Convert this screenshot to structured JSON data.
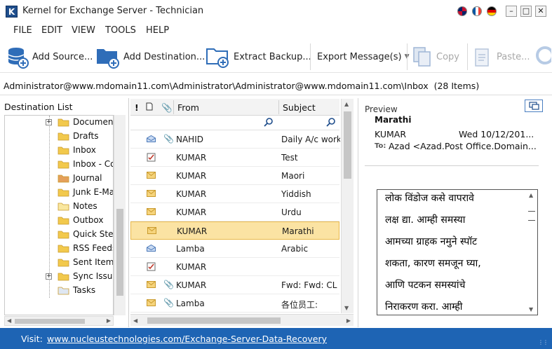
{
  "window": {
    "title": "Kernel for Exchange Server - Technician",
    "app_icon_letter": "K",
    "languages": [
      "English",
      "French",
      "German"
    ]
  },
  "menu": [
    "FILE",
    "EDIT",
    "VIEW",
    "TOOLS",
    "HELP"
  ],
  "toolbar": {
    "add_source": "Add Source...",
    "add_destination": "Add Destination...",
    "extract_backup": "Extract Backup...",
    "export_messages": "Export Message(s)",
    "copy": "Copy",
    "paste": "Paste..."
  },
  "path": {
    "location": "Administrator@www.mdomain11.com\\Administrator\\Administrator@www.mdomain11.com\\Inbox",
    "count": "(28 Items)"
  },
  "destination": {
    "title": "Destination List",
    "items": [
      {
        "label": "Documents",
        "expander": "+"
      },
      {
        "label": "Drafts",
        "expander": ""
      },
      {
        "label": "Inbox",
        "expander": ""
      },
      {
        "label": "Inbox - Co",
        "expander": ""
      },
      {
        "label": "Journal",
        "expander": ""
      },
      {
        "label": "Junk E-Ma",
        "expander": ""
      },
      {
        "label": "Notes",
        "expander": ""
      },
      {
        "label": "Outbox",
        "expander": ""
      },
      {
        "label": "Quick Step",
        "expander": ""
      },
      {
        "label": "RSS Feeds",
        "expander": ""
      },
      {
        "label": "Sent Items",
        "expander": ""
      },
      {
        "label": "Sync Issue",
        "expander": "+"
      },
      {
        "label": "Tasks",
        "expander": ""
      }
    ]
  },
  "messages": {
    "columns": {
      "importance": "!",
      "type": "",
      "attach": "",
      "from": "From",
      "subject": "Subject"
    },
    "rows": [
      {
        "from": "NAHID",
        "subject": "Daily A/c work ",
        "attach": true,
        "icon": "envelope-open"
      },
      {
        "from": "KUMAR",
        "subject": "Test",
        "attach": false,
        "icon": "task"
      },
      {
        "from": "KUMAR",
        "subject": "Maori",
        "attach": false,
        "icon": "envelope"
      },
      {
        "from": "KUMAR",
        "subject": "Yiddish",
        "attach": false,
        "icon": "envelope"
      },
      {
        "from": "KUMAR",
        "subject": "Urdu",
        "attach": false,
        "icon": "envelope"
      },
      {
        "from": "KUMAR",
        "subject": "Marathi",
        "attach": false,
        "icon": "envelope",
        "selected": true
      },
      {
        "from": "Lamba",
        "subject": "Arabic",
        "attach": false,
        "icon": "envelope-open"
      },
      {
        "from": "KUMAR",
        "subject": "",
        "attach": false,
        "icon": "task"
      },
      {
        "from": "KUMAR",
        "subject": "Fwd:  Fwd: CL C",
        "attach": true,
        "icon": "envelope"
      },
      {
        "from": "Lamba",
        "subject": "各位员工:",
        "attach": true,
        "icon": "envelope"
      }
    ]
  },
  "preview": {
    "label": "Preview",
    "subject": "Marathi",
    "from": "KUMAR",
    "date": "Wed 10/12/201...",
    "to_label": "To:",
    "to": "Azad <Azad.Post Office.Domain...",
    "body_lines": [
      "लोक विंडोज कसे वापरावे",
      "लक्ष द्या. आम्ही समस्या",
      "आमच्या ग्राहक नमुने स्पॉट",
      "शकता, कारण समजून घ्या,",
      "आणि पटकन समस्यांचे",
      "निराकरण करा. आम्ही"
    ]
  },
  "status": {
    "label": "Visit:",
    "link": "www.nucleustechnologies.com/Exchange-Server-Data-Recovery"
  }
}
